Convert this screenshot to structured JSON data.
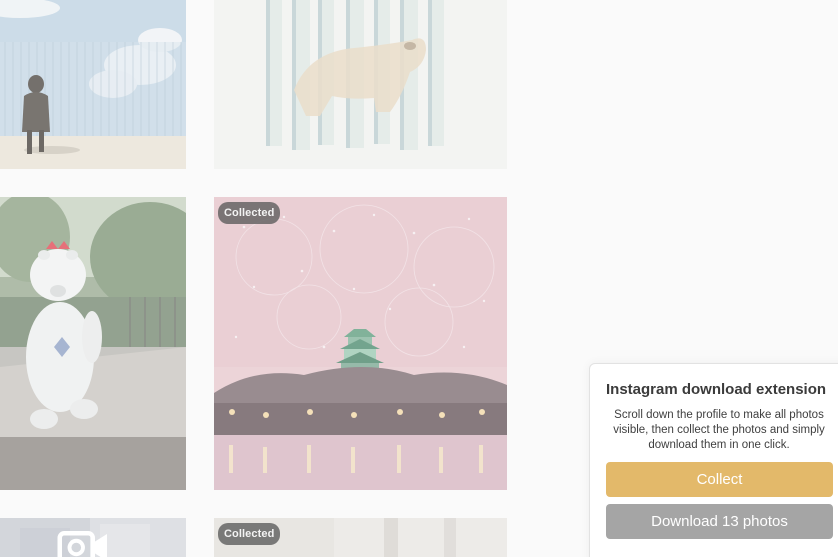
{
  "grid": {
    "tiles": [
      {
        "name": "photo-person-fence"
      },
      {
        "name": "photo-polar-bear-strips"
      },
      {
        "name": "photo-polar-bear-mascot"
      },
      {
        "name": "photo-castle-fireworks",
        "badge": "Collected"
      },
      {
        "name": "photo-video-bottom-left",
        "icon": "video-camera-icon"
      },
      {
        "name": "photo-bottom-right",
        "badge": "Collected"
      }
    ]
  },
  "extension_panel": {
    "title": "Instagram download extension",
    "description": "Scroll down the profile to make all photos visible, then collect the photos and simply download them in one click.",
    "collect_label": "Collect",
    "download_label": "Download 13 photos",
    "colors": {
      "collect": "#e3b96a",
      "download": "#a5a5a5"
    }
  }
}
